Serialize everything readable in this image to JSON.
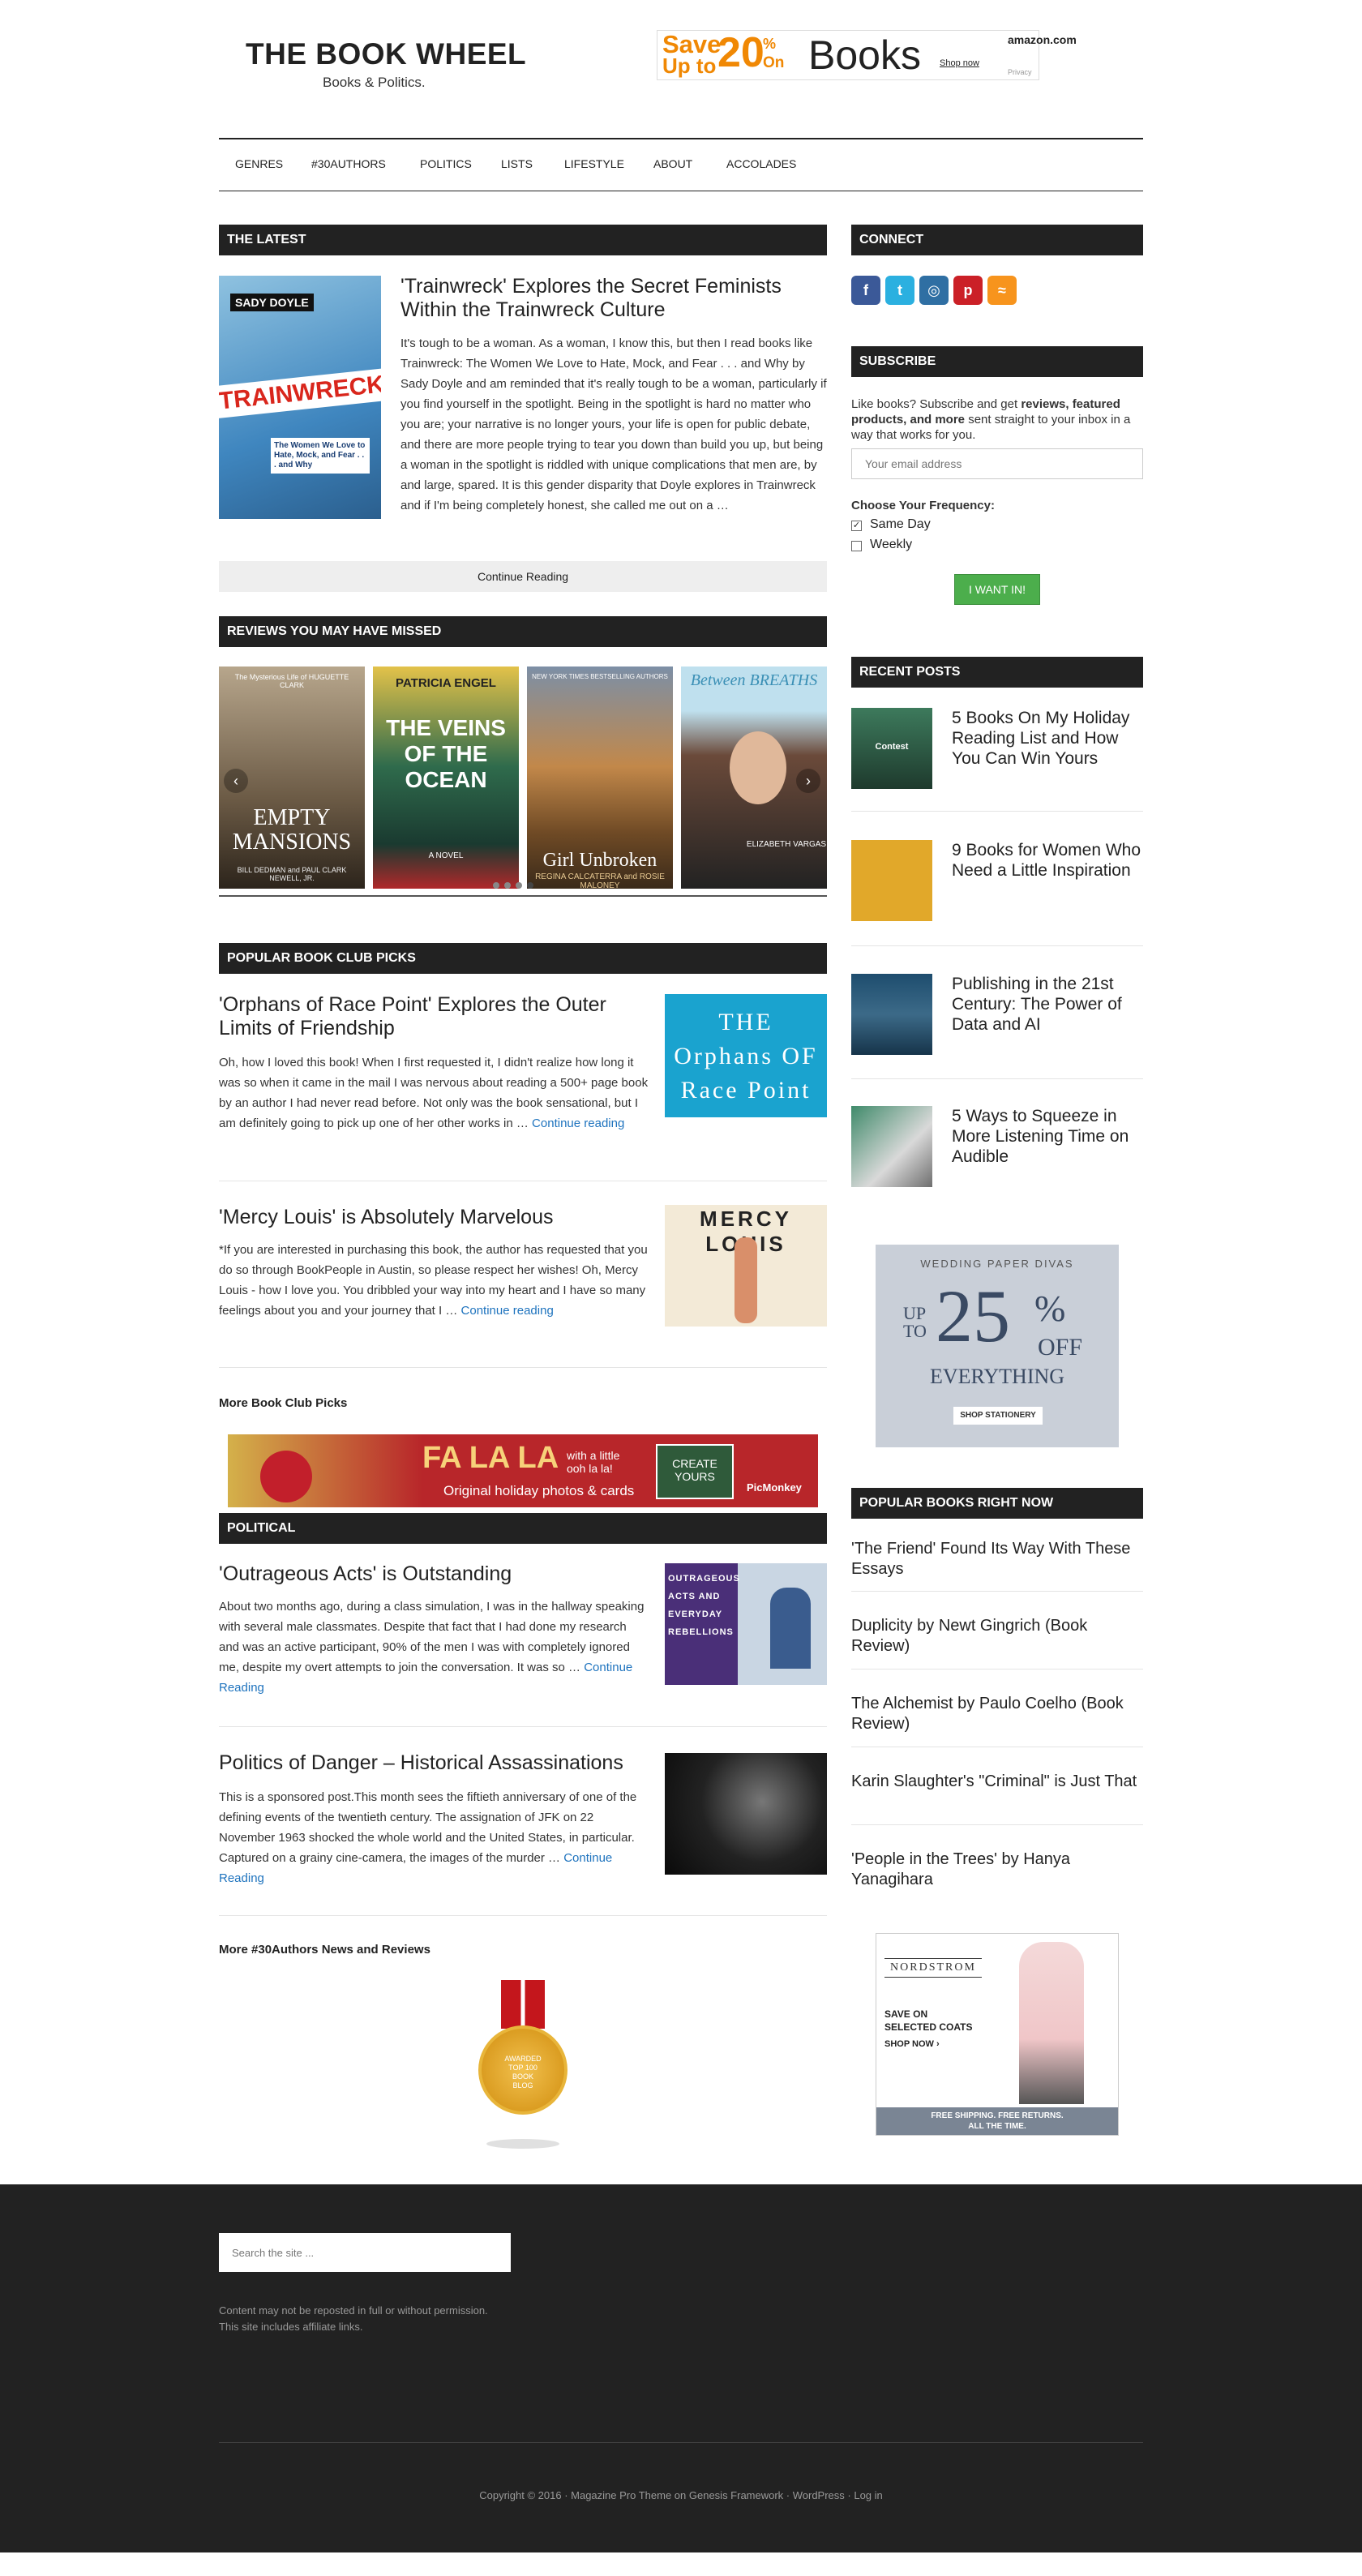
{
  "site": {
    "title": "THE BOOK WHEEL",
    "tagline": "Books & Politics."
  },
  "ad_top": {
    "save": "Save",
    "up_to": "Up to",
    "number": "20",
    "percent": "%",
    "on": "On",
    "books": "Books",
    "brand": "amazon.com",
    "shop_now": "Shop now",
    "privacy": "Privacy"
  },
  "nav": [
    "GENRES",
    "#30AUTHORS",
    "POLITICS",
    "LISTS",
    "LIFESTYLE",
    "ABOUT",
    "ACCOLADES"
  ],
  "latest": {
    "heading": "THE LATEST",
    "title": "'Trainwreck' Explores the Secret Feminists Within the Trainwreck Culture",
    "excerpt": "It's tough to be a woman. As a woman, I know this, but then I read books like Trainwreck: The Women We Love to Hate, Mock, and Fear . . . and Why by Sady Doyle and am reminded that it's really tough to be a woman, particularly if you find yourself in the spotlight. Being in the spotlight is hard no matter who you are; your narrative is no longer yours, your life is open for public debate, and there are more people trying to tear you down than build you up, but being a woman in the spotlight is riddled with unique complications that men are, by and large, spared. It is this gender disparity that Doyle explores in Trainwreck and if I'm being completely honest, she called me out on a …",
    "continue": "Continue Reading",
    "cover_author": "SADY DOYLE",
    "cover_title": "TRAINWRECK",
    "cover_sub": "The Women We Love to Hate, Mock, and Fear . . . and Why"
  },
  "reviews": {
    "heading": "REVIEWS YOU MAY HAVE MISSED",
    "books": [
      {
        "title": "EMPTY MANSIONS",
        "top": "The Mysterious Life of HUGUETTE CLARK",
        "authors": "BILL DEDMAN and PAUL CLARK NEWELL, JR."
      },
      {
        "title": "THE VEINS OF THE OCEAN",
        "top": "PATRICIA ENGEL",
        "authors": "A NOVEL"
      },
      {
        "title": "Girl Unbroken",
        "top": "NEW YORK TIMES BESTSELLING AUTHORS",
        "authors": "REGINA CALCATERRA and ROSIE MALONEY"
      },
      {
        "title": "Between BREATHS",
        "top": "",
        "authors": "ELIZABETH VARGAS"
      }
    ]
  },
  "book_club": {
    "heading": "POPULAR BOOK CLUB PICKS",
    "posts": [
      {
        "title": "'Orphans of Race Point' Explores the Outer Limits of Friendship",
        "excerpt": "Oh, how I loved this book! When I first requested it, I didn't realize how long it was so when it came in the mail I was nervous about reading a 500+ page book by an author I had never read before. Not only was the book sensational, but I am definitely going to pick up one of her other works in … ",
        "link": "Continue reading",
        "cover": "THE Orphans OF Race Point"
      },
      {
        "title": "'Mercy Louis' is Absolutely Marvelous",
        "excerpt": "*If you are interested in purchasing this book, the author has requested that you do so through BookPeople in Austin, so please respect her wishes! Oh, Mercy Louis - how I love you. You dribbled your way into my heart and I have so many feelings about you and your journey that I … ",
        "link": "Continue reading",
        "cover": "MERCY LOUIS"
      }
    ],
    "more": "More Book Club Picks"
  },
  "ad_middle": {
    "text": "FA LA LA",
    "sub": "with a little ooh la la!",
    "caption": "Original holiday photos & cards",
    "cta": "CREATE YOURS",
    "brand": "PicMonkey"
  },
  "political": {
    "heading": "POLITICAL",
    "posts": [
      {
        "title": "'Outrageous Acts' is Outstanding",
        "excerpt": "About two months ago, during a class simulation, I was in the hallway speaking with several male classmates. Despite that fact that I had done my research and was an active participant,  90% of the men I was with completely ignored me, despite my overt attempts to join the conversation. It was so … ",
        "link": "Continue Reading",
        "cover": "OUTRAGEOUS ACTS AND EVERYDAY REBELLIONS"
      },
      {
        "title": "Politics of Danger – Historical Assassinations",
        "excerpt": "This is a sponsored post.This month sees the fiftieth anniversary of one of the defining events of the twentieth century. The assignation of JFK on 22 November 1963 shocked the whole world and the United States, in particular. Captured on a grainy cine-camera, the images of the murder … ",
        "link": "Continue Reading"
      }
    ],
    "more": "More #30Authors News and Reviews"
  },
  "badge": {
    "line1": "AWARDED",
    "line2": "TOP 100",
    "line3": "BOOK",
    "line4": "BLOG"
  },
  "sidebar": {
    "connect": "CONNECT",
    "social": [
      "f",
      "t",
      "◎",
      "p",
      "≈"
    ],
    "subscribe": {
      "heading": "SUBSCRIBE",
      "intro_a": "Like books? Subscribe and get ",
      "intro_b": "reviews, featured products, and more",
      "intro_c": " sent straight to your inbox in a way that works for you.",
      "placeholder": "Your email address",
      "frequency": "Choose Your Frequency:",
      "opt1": "Same Day",
      "opt2": "Weekly",
      "button": "I WANT IN!"
    },
    "recent": {
      "heading": "RECENT POSTS",
      "items": [
        "5 Books On My Holiday Reading List and How You Can Win Yours",
        "9 Books for Women Who Need a Little Inspiration",
        "Publishing in the 21st Century: The Power of Data and AI",
        "5 Ways to Squeeze in More Listening Time on Audible"
      ],
      "thumb1_label": "Contest"
    },
    "ad_wpd": {
      "brand": "WEDDING PAPER DIVAS",
      "up": "UP",
      "to": "TO",
      "num": "25",
      "pct": "%",
      "off": "OFF",
      "everything": "EVERYTHING",
      "cta": "SHOP STATIONERY"
    },
    "popular": {
      "heading": "POPULAR BOOKS RIGHT NOW",
      "items": [
        "'The Friend' Found Its Way With These Essays",
        "Duplicity by Newt Gingrich (Book Review)",
        "The Alchemist by Paulo Coelho (Book Review)",
        "Karin Slaughter's \"Criminal\" is Just That",
        "'People in the Trees' by Hanya Yanagihara"
      ]
    },
    "ad_nordstrom": {
      "brand": "NORDSTROM",
      "line1": "SAVE ON",
      "line2": "SELECTED COATS",
      "cta": "SHOP NOW ›",
      "foot1": "FREE SHIPPING. FREE RETURNS.",
      "foot2": "ALL THE TIME."
    }
  },
  "footer": {
    "search_placeholder": "Search the site ...",
    "note1": "Content may not be reposted in full or without permission.",
    "note2": "This site includes affiliate links.",
    "copyright": "Copyright © 2016 · Magazine Pro Theme on Genesis Framework · WordPress · Log in"
  },
  "colors": {
    "dark": "#222222",
    "link": "#1e73be",
    "button": "#4cae4c",
    "orange": "#f08804"
  }
}
